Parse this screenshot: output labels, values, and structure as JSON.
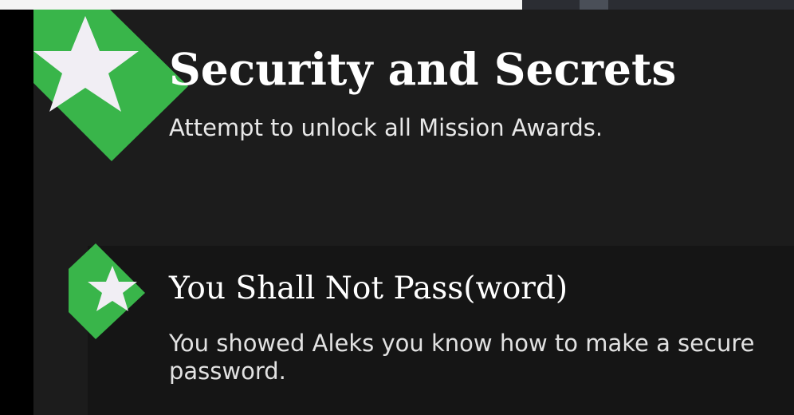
{
  "category": {
    "title": "Security and Secrets",
    "subtitle": "Attempt to unlock all Mission Awards.",
    "badge_icon": "star-icon"
  },
  "awards": [
    {
      "title": "You Shall Not Pass(word)",
      "description": "You showed Aleks you know how to make a secure password.",
      "badge_icon": "star-icon",
      "unlocked": true
    }
  ],
  "colors": {
    "badge_green": "#39b54a",
    "star": "#f1eef4",
    "panel_bg": "#1c1c1c",
    "row_bg": "#151515",
    "text": "#ffffff"
  }
}
